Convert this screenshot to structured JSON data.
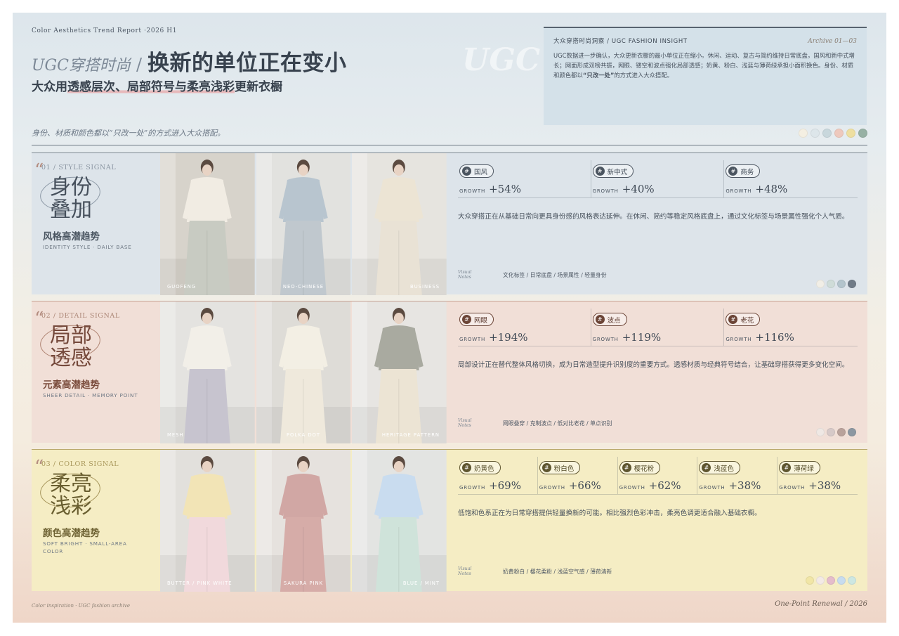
{
  "header": {
    "kicker": "Color Aesthetics Trend Report ·2026 H1",
    "title_left": "UGC穿搭时尚",
    "title_sep": "/",
    "title_main": "换新的单位正在变小",
    "subtitle_pre": "大众用",
    "subtitle_hl": "透感层次、局部符号与柔亮浅彩",
    "subtitle_post": "更新衣橱",
    "tagline": "身份、材质和颜色都以“只改一处”的方式进入大众搭配。",
    "watermark": "UGC Fa",
    "swatches": [
      "#f4efe2",
      "#dde6ea",
      "#c8d7dc",
      "#eec9bd",
      "#eedfa0",
      "#97b1a4"
    ]
  },
  "insight": {
    "title": "大众穿搭时尚洞察 / UGC FASHION INSIGHT",
    "archive": "Archive 01—03",
    "body_pre": "UGC数据进一步确认，大众更新衣橱的最小单位正在缩小。休闲、运动、复古与简约维持日常底盘，国风和新中式增长；网面形成双榜共振，网眼、镂空和波点强化局部透感；奶黄、粉白、浅蓝与薄荷绿承担小面积换色。身份、材质和颜色都以",
    "body_bold": "“只改一处”",
    "body_post": "的方式进入大众搭配。"
  },
  "sections": [
    {
      "label": "01 / STYLE SIGNAL",
      "big_line1": "身份",
      "big_line2": "叠加",
      "cn": "风格高潜趋势",
      "en": "IDENTITY STYLE · DAILY BASE",
      "photos": [
        {
          "caption": "GUOFENG",
          "bg": "#d7d3cb",
          "body": "#f1ece3",
          "legs": "#c8cbc2"
        },
        {
          "caption": "NEO-CHINESE",
          "bg": "#e2e2df",
          "body": "#b8c5cf",
          "legs": "#c0c8ce"
        },
        {
          "caption": "BUSINESS",
          "bg": "#e6e4df",
          "body": "#ece4d4",
          "legs": "#e9e2d5"
        }
      ],
      "tags": [
        {
          "name": "国风",
          "growth": "+54%"
        },
        {
          "name": "新中式",
          "growth": "+40%"
        },
        {
          "name": "商务",
          "growth": "+48%"
        }
      ],
      "growth_label": "GROWTH",
      "desc": "大众穿搭正在从基础日常向更具身份感的风格表达延伸。在休闲、简约等稳定风格底盘上，通过文化标签与场景属性强化个人气质。",
      "notes_label_1": "Visual",
      "notes_label_2": "Notes",
      "notes": "文化标签 / 日常底盘 / 场景属性 / 轻量身份",
      "swatches": [
        "#f1eee6",
        "#cfdcd8",
        "#b3c4cc",
        "#707b87"
      ]
    },
    {
      "label": "02 / DETAIL SIGNAL",
      "big_line1": "局部",
      "big_line2": "透感",
      "cn": "元素高潜趋势",
      "en": "SHEER DETAIL · MEMORY POINT",
      "photos": [
        {
          "caption": "MESH",
          "bg": "#e4e3e0",
          "body": "#f2efe8",
          "legs": "#c7c4cf"
        },
        {
          "caption": "POLKA DOT",
          "bg": "#dedcd7",
          "body": "#f3efe4",
          "legs": "#efe9dc"
        },
        {
          "caption": "HERITAGE PATTERN",
          "bg": "#e7e5e2",
          "body": "#a9aaa0",
          "legs": "#ece4d4"
        }
      ],
      "tags": [
        {
          "name": "网眼",
          "growth": "+194%"
        },
        {
          "name": "波点",
          "growth": "+119%"
        },
        {
          "name": "老花",
          "growth": "+116%"
        }
      ],
      "growth_label": "GROWTH",
      "desc": "局部设计正在替代整体风格切换，成为日常造型提升识别度的重要方式。透感材质与经典符号结合，让基础穿搭获得更多变化空间。",
      "notes_label_1": "Visual",
      "notes_label_2": "Notes",
      "notes": "网眼叠穿 / 克制波点 / 低对比老花 / 单点识别",
      "swatches": [
        "#efe8e4",
        "#d6c9c8",
        "#b9a29b",
        "#8c97a1"
      ]
    },
    {
      "label": "03 / COLOR SIGNAL",
      "big_line1": "柔亮",
      "big_line2": "浅彩",
      "cn": "颜色高潜趋势",
      "en": "SOFT BRIGHT · SMALL-AREA COLOR",
      "photos": [
        {
          "caption": "BUTTER / PINK WHITE",
          "bg": "#e2e0dc",
          "body": "#f2e4b6",
          "legs": "#f1d9dc"
        },
        {
          "caption": "SAKURA PINK",
          "bg": "#e6e2de",
          "body": "#d1a7a4",
          "legs": "#d6aca8"
        },
        {
          "caption": "BLUE / MINT",
          "bg": "#e3e4e2",
          "body": "#c9dcef",
          "legs": "#cfe3da"
        }
      ],
      "tags": [
        {
          "name": "奶黄色",
          "growth": "+69%"
        },
        {
          "name": "粉白色",
          "growth": "+66%"
        },
        {
          "name": "樱花粉",
          "growth": "+62%"
        },
        {
          "name": "浅蓝色",
          "growth": "+38%"
        },
        {
          "name": "薄荷绿",
          "growth": "+38%"
        }
      ],
      "growth_label": "GROWTH",
      "desc": "低饱和色系正在为日常穿搭提供轻量换新的可能。相比强烈色彩冲击，柔亮色调更适合融入基础衣橱。",
      "notes_label_1": "Visual",
      "notes_label_2": "Notes",
      "notes": "奶黄粉白 / 樱花柔粉 / 浅蓝空气感 / 薄荷清新",
      "swatches": [
        "#f1e6a6",
        "#f3eae6",
        "#e5bccb",
        "#c7dcef",
        "#cde7e2"
      ]
    }
  ],
  "footer": {
    "left": "Color inspiration · UGC fashion archive",
    "right": "One-Point Renewal / 2026"
  }
}
